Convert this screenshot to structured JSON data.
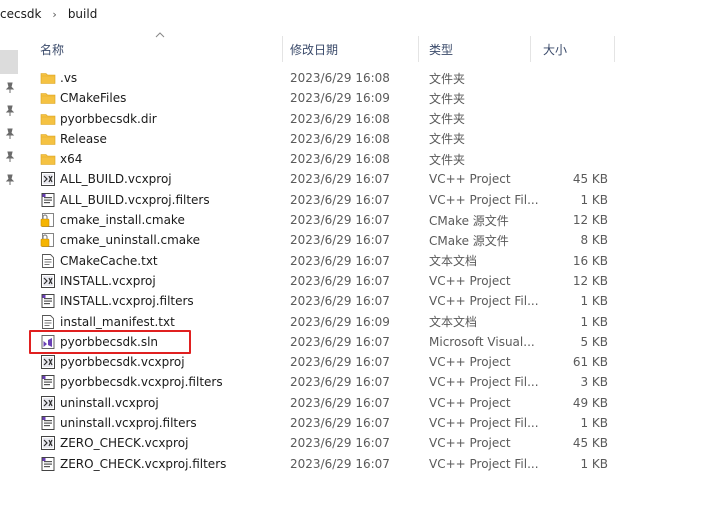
{
  "breadcrumb": {
    "items": [
      "cecsdk",
      "build"
    ],
    "separator": "›"
  },
  "columns": {
    "name": "名称",
    "date": "修改日期",
    "type": "类型",
    "size": "大小"
  },
  "files": [
    {
      "name": ".vs",
      "date": "2023/6/29 16:08",
      "type": "文件夹",
      "size": "",
      "icon": "folder-icon"
    },
    {
      "name": "CMakeFiles",
      "date": "2023/6/29 16:09",
      "type": "文件夹",
      "size": "",
      "icon": "folder-icon"
    },
    {
      "name": "pyorbbecsdk.dir",
      "date": "2023/6/29 16:08",
      "type": "文件夹",
      "size": "",
      "icon": "folder-icon"
    },
    {
      "name": "Release",
      "date": "2023/6/29 16:08",
      "type": "文件夹",
      "size": "",
      "icon": "folder-icon"
    },
    {
      "name": "x64",
      "date": "2023/6/29 16:08",
      "type": "文件夹",
      "size": "",
      "icon": "folder-icon"
    },
    {
      "name": "ALL_BUILD.vcxproj",
      "date": "2023/6/29 16:07",
      "type": "VC++ Project",
      "size": "45 KB",
      "icon": "vcxproj-icon"
    },
    {
      "name": "ALL_BUILD.vcxproj.filters",
      "date": "2023/6/29 16:07",
      "type": "VC++ Project Fil...",
      "size": "1 KB",
      "icon": "filters-icon"
    },
    {
      "name": "cmake_install.cmake",
      "date": "2023/6/29 16:07",
      "type": "CMake 源文件",
      "size": "12 KB",
      "icon": "cmake-file-icon"
    },
    {
      "name": "cmake_uninstall.cmake",
      "date": "2023/6/29 16:07",
      "type": "CMake 源文件",
      "size": "8 KB",
      "icon": "cmake-file-icon"
    },
    {
      "name": "CMakeCache.txt",
      "date": "2023/6/29 16:07",
      "type": "文本文档",
      "size": "16 KB",
      "icon": "text-file-icon"
    },
    {
      "name": "INSTALL.vcxproj",
      "date": "2023/6/29 16:07",
      "type": "VC++ Project",
      "size": "12 KB",
      "icon": "vcxproj-icon"
    },
    {
      "name": "INSTALL.vcxproj.filters",
      "date": "2023/6/29 16:07",
      "type": "VC++ Project Fil...",
      "size": "1 KB",
      "icon": "filters-icon"
    },
    {
      "name": "install_manifest.txt",
      "date": "2023/6/29 16:09",
      "type": "文本文档",
      "size": "1 KB",
      "icon": "text-file-icon"
    },
    {
      "name": "pyorbbecsdk.sln",
      "date": "2023/6/29 16:07",
      "type": "Microsoft Visual...",
      "size": "5 KB",
      "icon": "sln-icon"
    },
    {
      "name": "pyorbbecsdk.vcxproj",
      "date": "2023/6/29 16:07",
      "type": "VC++ Project",
      "size": "61 KB",
      "icon": "vcxproj-icon"
    },
    {
      "name": "pyorbbecsdk.vcxproj.filters",
      "date": "2023/6/29 16:07",
      "type": "VC++ Project Fil...",
      "size": "3 KB",
      "icon": "filters-icon"
    },
    {
      "name": "uninstall.vcxproj",
      "date": "2023/6/29 16:07",
      "type": "VC++ Project",
      "size": "49 KB",
      "icon": "vcxproj-icon"
    },
    {
      "name": "uninstall.vcxproj.filters",
      "date": "2023/6/29 16:07",
      "type": "VC++ Project Fil...",
      "size": "1 KB",
      "icon": "filters-icon"
    },
    {
      "name": "ZERO_CHECK.vcxproj",
      "date": "2023/6/29 16:07",
      "type": "VC++ Project",
      "size": "45 KB",
      "icon": "vcxproj-icon"
    },
    {
      "name": "ZERO_CHECK.vcxproj.filters",
      "date": "2023/6/29 16:07",
      "type": "VC++ Project Fil...",
      "size": "1 KB",
      "icon": "filters-icon"
    }
  ],
  "colors": {
    "highlight_box": "#e02020",
    "folder": "#f5c242",
    "nav_selected": "#dcdcdc",
    "vs_purple": "#6a3fb5"
  }
}
